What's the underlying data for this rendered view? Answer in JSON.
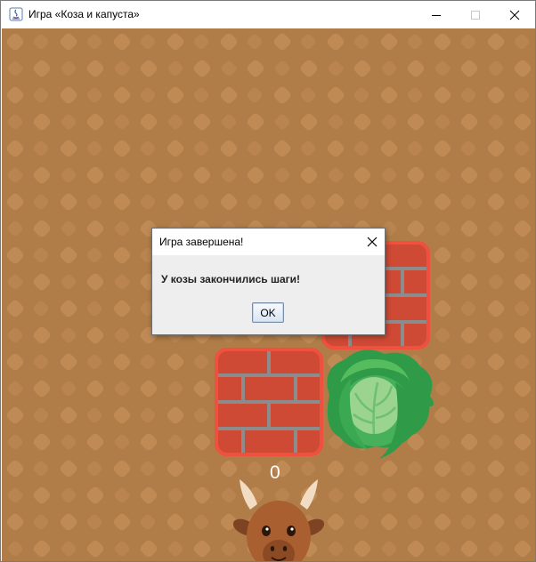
{
  "window": {
    "title": "Игра «Коза и капуста»"
  },
  "game": {
    "goat_steps": "0",
    "colors": {
      "ground": "#b07d48",
      "pattern": "#c08a55",
      "brick": "#cf4a35",
      "brick_outline": "#f0503e",
      "mortar": "#8c8c8c",
      "cabbage_dark": "#39a650",
      "cabbage_light": "#9ad48e",
      "goat": "#a95f30"
    }
  },
  "dialog": {
    "title": "Игра завершена!",
    "message": "У козы закончились шаги!",
    "ok_label": "OK"
  }
}
